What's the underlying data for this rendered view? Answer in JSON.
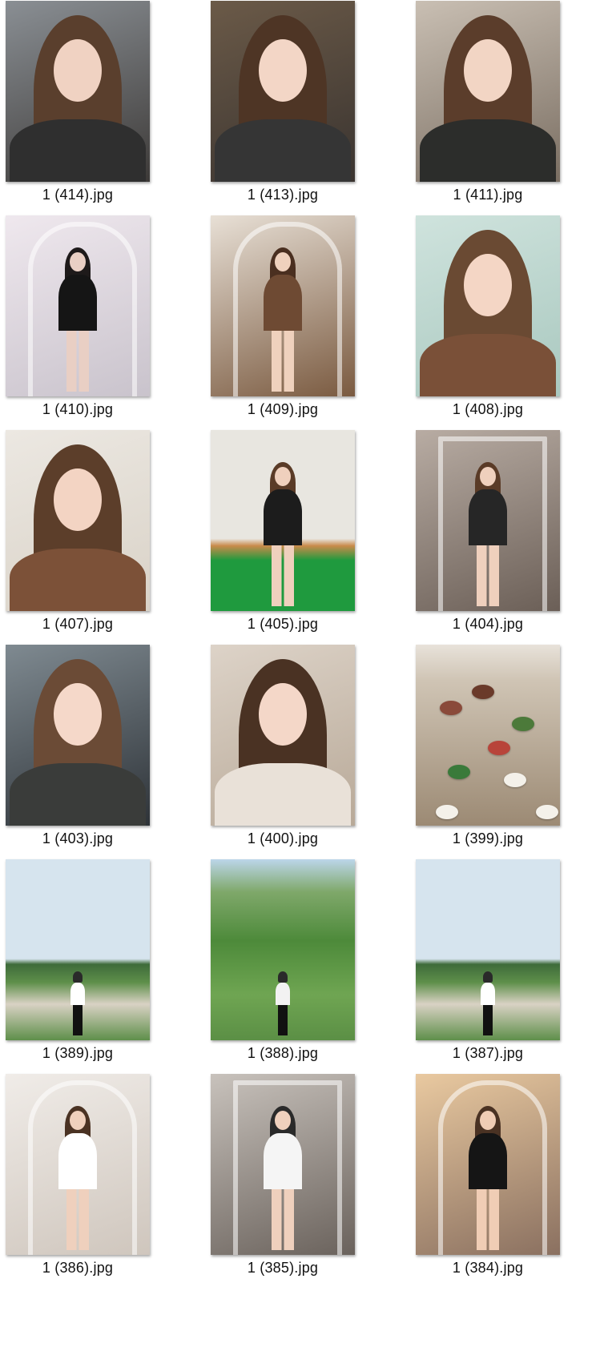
{
  "files": [
    {
      "name": "1 (414).jpg",
      "scene": "indoor-selfie",
      "bg": [
        "#8a8f94",
        "#3d3a38"
      ],
      "hair": "#5a3f2d",
      "skin": "#f0d2c2",
      "top": "#2f2f2f",
      "figure": "portrait"
    },
    {
      "name": "1 (413).jpg",
      "scene": "indoor-selfie",
      "bg": [
        "#6b5a48",
        "#3a3430"
      ],
      "hair": "#4e3525",
      "skin": "#f3d6c6",
      "top": "#353535",
      "figure": "portrait"
    },
    {
      "name": "1 (411).jpg",
      "scene": "indoor-selfie",
      "bg": [
        "#c9bfb3",
        "#7a6e62"
      ],
      "hair": "#5b3d2b",
      "skin": "#f2d5c4",
      "top": "#2c2d2b",
      "figure": "portrait"
    },
    {
      "name": "1 (410).jpg",
      "scene": "mirror-room",
      "bg": [
        "#efe8ee",
        "#c9c3cc"
      ],
      "hair": "#1e1a1a",
      "skin": "#e9cfc4",
      "top": "#151515",
      "figure": "full"
    },
    {
      "name": "1 (409).jpg",
      "scene": "mirror-room",
      "bg": [
        "#e8e0d6",
        "#7a5a40"
      ],
      "hair": "#4a2f20",
      "skin": "#efd1bd",
      "top": "#6e4a33",
      "figure": "full"
    },
    {
      "name": "1 (408).jpg",
      "scene": "indoor-selfie",
      "bg": [
        "#cfe3dd",
        "#a9c8bf"
      ],
      "hair": "#6a4a33",
      "skin": "#f4d6c5",
      "top": "#7a5038",
      "figure": "portrait"
    },
    {
      "name": "1 (407).jpg",
      "scene": "indoor-selfie",
      "bg": [
        "#ece8e2",
        "#d9d2c7"
      ],
      "hair": "#5c3e2a",
      "skin": "#f3d4c3",
      "top": "#7c5138",
      "figure": "portrait"
    },
    {
      "name": "1 (405).jpg",
      "scene": "golf-indoor",
      "bg": [
        "#e8e6e0",
        "#1f9a3e"
      ],
      "hair": "#5a3b27",
      "skin": "#efd0bd",
      "top": "#1c1c1c",
      "figure": "full"
    },
    {
      "name": "1 (404).jpg",
      "scene": "elevator",
      "bg": [
        "#b8aca3",
        "#6b5f57"
      ],
      "hair": "#5a3b27",
      "skin": "#efd0bd",
      "top": "#262626",
      "figure": "full"
    },
    {
      "name": "1 (403).jpg",
      "scene": "indoor-selfie",
      "bg": [
        "#7f8a91",
        "#2e3338"
      ],
      "hair": "#6b4b36",
      "skin": "#f5d8c9",
      "top": "#3a3c3a",
      "figure": "portrait"
    },
    {
      "name": "1 (400).jpg",
      "scene": "car-selfie",
      "bg": [
        "#ddd3c8",
        "#b8a998"
      ],
      "hair": "#4a3223",
      "skin": "#f4d7c8",
      "top": "#e9e1d8",
      "figure": "portrait"
    },
    {
      "name": "1 (399).jpg",
      "scene": "food-table",
      "bg": [
        "#cfc4b4",
        "#9c8a74"
      ],
      "hair": "#000000",
      "skin": "#000000",
      "top": "#000000",
      "figure": "none"
    },
    {
      "name": "1 (389).jpg",
      "scene": "golf-course",
      "bg": [
        "#d6e4ee",
        "#5e8f4a"
      ],
      "hair": "#2a2a2a",
      "skin": "#ecd0bc",
      "top": "#ffffff",
      "figure": "small"
    },
    {
      "name": "1 (388).jpg",
      "scene": "golf-hills",
      "bg": [
        "#bcd6ea",
        "#4d8a3a"
      ],
      "hair": "#2a2a2a",
      "skin": "#ecd0bc",
      "top": "#f2f2f2",
      "figure": "small"
    },
    {
      "name": "1 (387).jpg",
      "scene": "golf-course",
      "bg": [
        "#d6e4ee",
        "#5e8f4a"
      ],
      "hair": "#2a2a2a",
      "skin": "#ecd0bc",
      "top": "#ffffff",
      "figure": "small"
    },
    {
      "name": "1 (386).jpg",
      "scene": "mirror-room",
      "bg": [
        "#f0ece8",
        "#cfc6bd"
      ],
      "hair": "#4a3223",
      "skin": "#efd0bd",
      "top": "#ffffff",
      "figure": "full"
    },
    {
      "name": "1 (385).jpg",
      "scene": "elevator",
      "bg": [
        "#c8c2bc",
        "#6a625c"
      ],
      "hair": "#2a2a2a",
      "skin": "#efd0bd",
      "top": "#f5f5f5",
      "figure": "full"
    },
    {
      "name": "1 (384).jpg",
      "scene": "window-room",
      "bg": [
        "#e9c9a0",
        "#8a7060"
      ],
      "hair": "#4a3223",
      "skin": "#f0cdb5",
      "top": "#151515",
      "figure": "full"
    }
  ]
}
